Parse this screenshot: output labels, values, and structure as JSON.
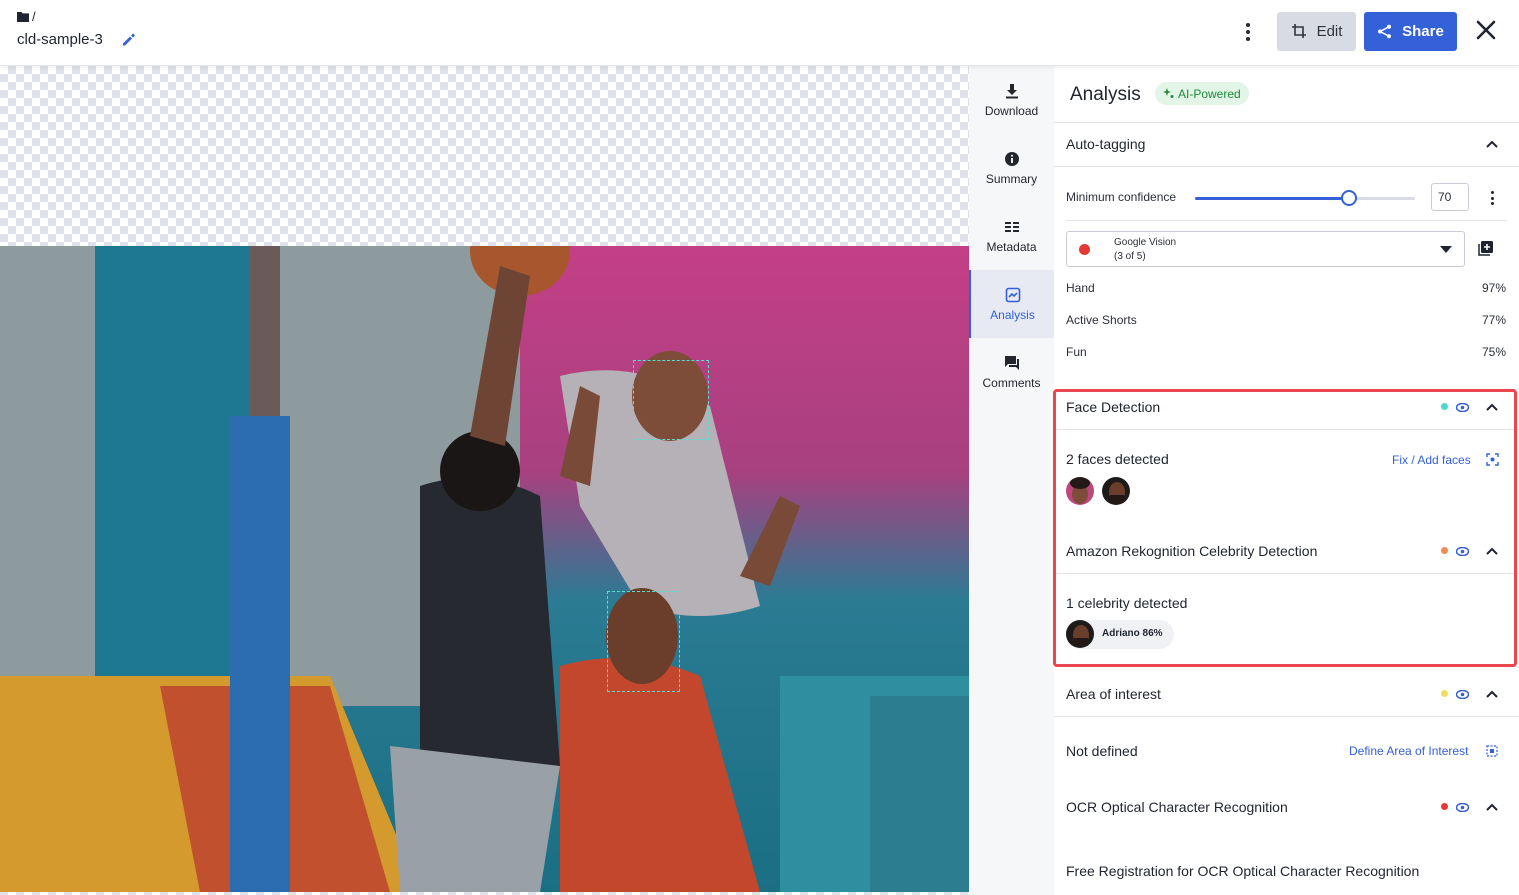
{
  "header": {
    "breadcrumb_sep": "/",
    "asset_name": "cld-sample-3",
    "edit_label": "Edit",
    "share_label": "Share"
  },
  "rail": {
    "items": [
      {
        "label": "Download",
        "icon": "download-icon"
      },
      {
        "label": "Summary",
        "icon": "info-icon"
      },
      {
        "label": "Metadata",
        "icon": "list-icon"
      },
      {
        "label": "Analysis",
        "icon": "analysis-icon",
        "active": true
      },
      {
        "label": "Comments",
        "icon": "comments-icon"
      }
    ]
  },
  "analysis": {
    "title": "Analysis",
    "badge": "AI-Powered",
    "auto_tagging": {
      "title": "Auto-tagging",
      "confidence_label": "Minimum confidence",
      "confidence_value": "70",
      "slider_fraction": 0.7,
      "provider_name": "Google Vision",
      "provider_count": "(3 of 5)",
      "tags": [
        {
          "name": "Hand",
          "value": "97%"
        },
        {
          "name": "Active Shorts",
          "value": "77%"
        },
        {
          "name": "Fun",
          "value": "75%"
        }
      ]
    },
    "face_detection": {
      "title": "Face Detection",
      "summary": "2 faces detected",
      "link": "Fix / Add faces",
      "dot_color": "#4dd9cf"
    },
    "celebrity": {
      "title": "Amazon Rekognition Celebrity Detection",
      "summary": "1 celebrity detected",
      "chip_label": "Adriano 86%",
      "dot_color": "#f28b50"
    },
    "area_of_interest": {
      "title": "Area of interest",
      "summary": "Not defined",
      "link": "Define Area of Interest",
      "dot_color": "#f2dc5d"
    },
    "ocr": {
      "title": "OCR Optical Character Recognition",
      "summary": "Free Registration for OCR Optical Character Recognition",
      "dot_color": "#e53935"
    }
  },
  "colors": {
    "accent": "#3461d8",
    "highlight": "#e9474d",
    "ai_badge_bg": "#e3f5e7",
    "ai_badge_text": "#1c8c3a"
  }
}
